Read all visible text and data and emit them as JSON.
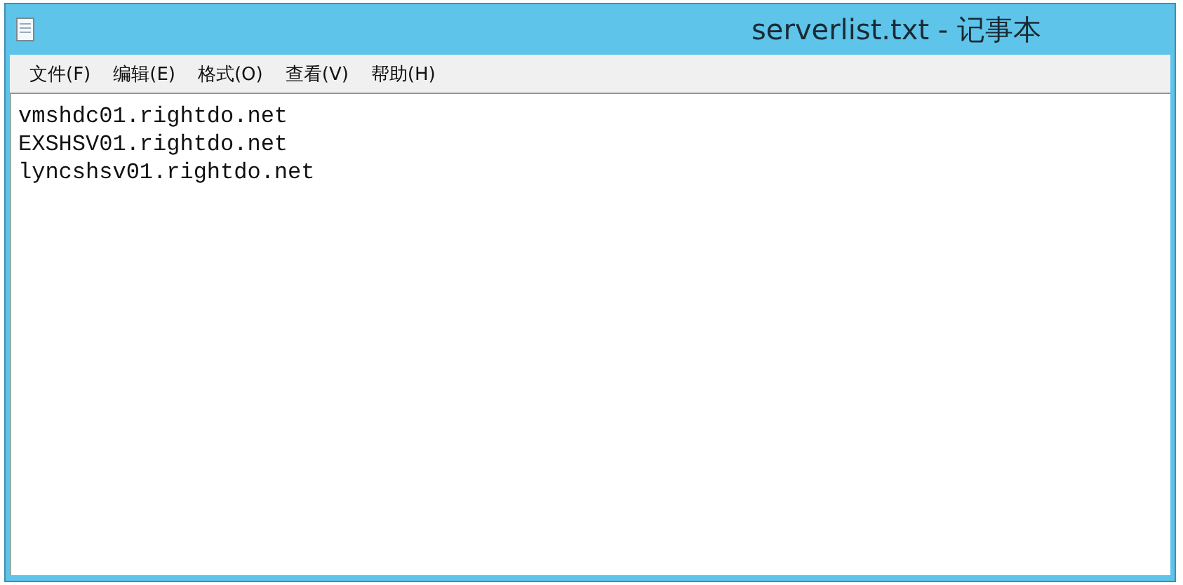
{
  "window": {
    "title": "serverlist.txt - 记事本"
  },
  "menu": [
    {
      "label": "文件(F)"
    },
    {
      "label": "编辑(E)"
    },
    {
      "label": "格式(O)"
    },
    {
      "label": "查看(V)"
    },
    {
      "label": "帮助(H)"
    }
  ],
  "editor": {
    "lines": [
      "vmshdc01.rightdo.net",
      "EXSHSV01.rightdo.net",
      "lyncshsv01.rightdo.net"
    ]
  }
}
